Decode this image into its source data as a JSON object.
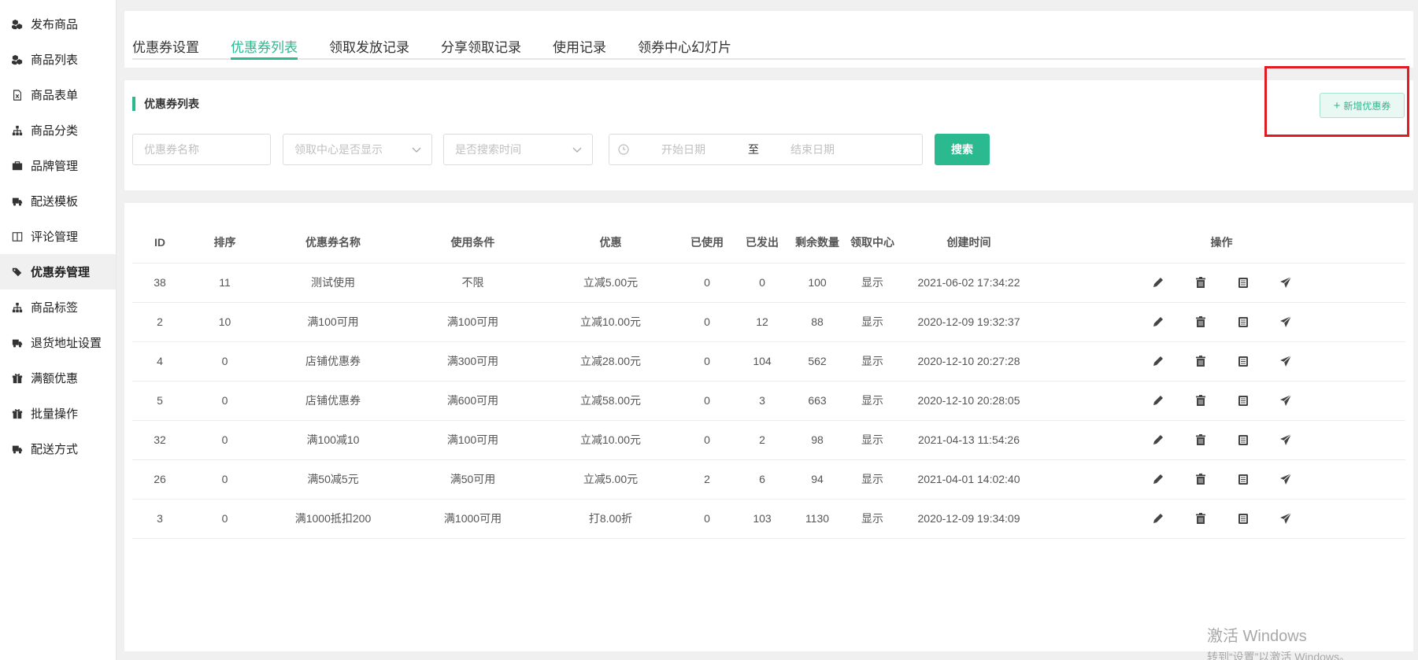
{
  "sidebar": {
    "items": [
      {
        "label": "发布商品",
        "icon": "cubes-icon"
      },
      {
        "label": "商品列表",
        "icon": "cubes-icon"
      },
      {
        "label": "商品表单",
        "icon": "excel-file-icon"
      },
      {
        "label": "商品分类",
        "icon": "sitemap-icon"
      },
      {
        "label": "品牌管理",
        "icon": "briefcase-icon"
      },
      {
        "label": "配送模板",
        "icon": "truck-icon"
      },
      {
        "label": "评论管理",
        "icon": "columns-icon"
      },
      {
        "label": "优惠券管理",
        "icon": "tags-icon",
        "active": true
      },
      {
        "label": "商品标签",
        "icon": "sitemap-icon"
      },
      {
        "label": "退货地址设置",
        "icon": "truck-icon"
      },
      {
        "label": "满额优惠",
        "icon": "gift-icon"
      },
      {
        "label": "批量操作",
        "icon": "gift-icon"
      },
      {
        "label": "配送方式",
        "icon": "truck-icon"
      }
    ]
  },
  "tabs": [
    {
      "label": "优惠券设置"
    },
    {
      "label": "优惠券列表",
      "active": true
    },
    {
      "label": "领取发放记录"
    },
    {
      "label": "分享领取记录"
    },
    {
      "label": "使用记录"
    },
    {
      "label": "领券中心幻灯片"
    }
  ],
  "filter": {
    "section_title": "优惠券列表",
    "add_button": "新增优惠券",
    "name_placeholder": "优惠券名称",
    "show_placeholder": "领取中心是否显示",
    "time_placeholder": "是否搜索时间",
    "start_placeholder": "开始日期",
    "date_separator": "至",
    "end_placeholder": "结束日期",
    "search_button": "搜索"
  },
  "table": {
    "headers": [
      "ID",
      "排序",
      "优惠券名称",
      "使用条件",
      "优惠",
      "已使用",
      "已发出",
      "剩余数量",
      "领取中心",
      "创建时间",
      "操作"
    ],
    "rows": [
      {
        "id": "38",
        "sort": "11",
        "name": "测试使用",
        "condition": "不限",
        "discount": "立减5.00元",
        "used": "0",
        "issued": "0",
        "remaining": "100",
        "center": "显示",
        "created": "2021-06-02 17:34:22"
      },
      {
        "id": "2",
        "sort": "10",
        "name": "满100可用",
        "condition": "满100可用",
        "discount": "立减10.00元",
        "used": "0",
        "issued": "12",
        "remaining": "88",
        "center": "显示",
        "created": "2020-12-09 19:32:37"
      },
      {
        "id": "4",
        "sort": "0",
        "name": "店铺优惠券",
        "condition": "满300可用",
        "discount": "立减28.00元",
        "used": "0",
        "issued": "104",
        "remaining": "562",
        "center": "显示",
        "created": "2020-12-10 20:27:28"
      },
      {
        "id": "5",
        "sort": "0",
        "name": "店铺优惠券",
        "condition": "满600可用",
        "discount": "立减58.00元",
        "used": "0",
        "issued": "3",
        "remaining": "663",
        "center": "显示",
        "created": "2020-12-10 20:28:05"
      },
      {
        "id": "32",
        "sort": "0",
        "name": "满100减10",
        "condition": "满100可用",
        "discount": "立减10.00元",
        "used": "0",
        "issued": "2",
        "remaining": "98",
        "center": "显示",
        "created": "2021-04-13 11:54:26"
      },
      {
        "id": "26",
        "sort": "0",
        "name": "满50减5元",
        "condition": "满50可用",
        "discount": "立减5.00元",
        "used": "2",
        "issued": "6",
        "remaining": "94",
        "center": "显示",
        "created": "2021-04-01 14:02:40"
      },
      {
        "id": "3",
        "sort": "0",
        "name": "满1000抵扣200",
        "condition": "满1000可用",
        "discount": "打8.00折",
        "used": "0",
        "issued": "103",
        "remaining": "1130",
        "center": "显示",
        "created": "2020-12-09 19:34:09"
      }
    ],
    "row_actions": [
      "edit-icon",
      "trash-icon",
      "clipboard-icon",
      "send-icon"
    ]
  },
  "watermark": {
    "line1": "激活 Windows",
    "line2": "转到“设置”以激活 Windows。"
  },
  "colors": {
    "accent": "#2bb98f",
    "highlight": "#e01b22"
  }
}
